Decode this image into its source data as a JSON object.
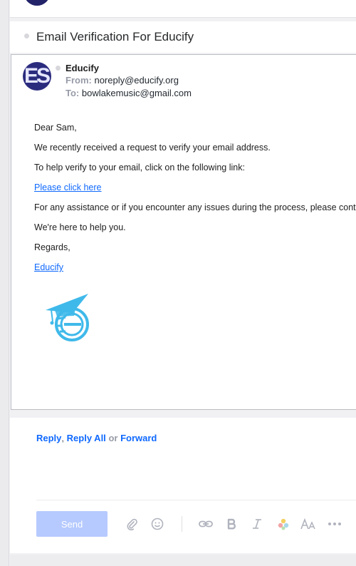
{
  "subject": "Email Verification For Educify",
  "sender": {
    "avatar_text": "ES",
    "name": "Educify",
    "from_label": "From:",
    "from_email": "noreply@educify.org",
    "to_label": "To:",
    "to_email": "bowlakemusic@gmail.com"
  },
  "body": {
    "greeting": "Dear Sam,",
    "line1": "We recently received a request to verify your email address.",
    "line2": "To help verify to your email, click on the following link:",
    "verify_link": "Please click here",
    "line3": "For any assistance or if you encounter any issues during the process, please contact",
    "line4": "We're here to help you.",
    "regards": "Regards,",
    "signature_link": "Educify"
  },
  "reply_actions": {
    "reply": "Reply",
    "comma": ",",
    "reply_all": "Reply All",
    "or": "or",
    "forward": "Forward"
  },
  "composer": {
    "send_label": "Send"
  },
  "colors": {
    "link": "#0f69ff",
    "send_disabled": "#b6caff",
    "logo": "#3fb9ea",
    "avatar": "#2b2b7e"
  },
  "icons": [
    "attachment-icon",
    "emoji-icon",
    "link-icon",
    "bold-icon",
    "italic-icon",
    "color-icon",
    "font-size-icon",
    "more-icon"
  ]
}
